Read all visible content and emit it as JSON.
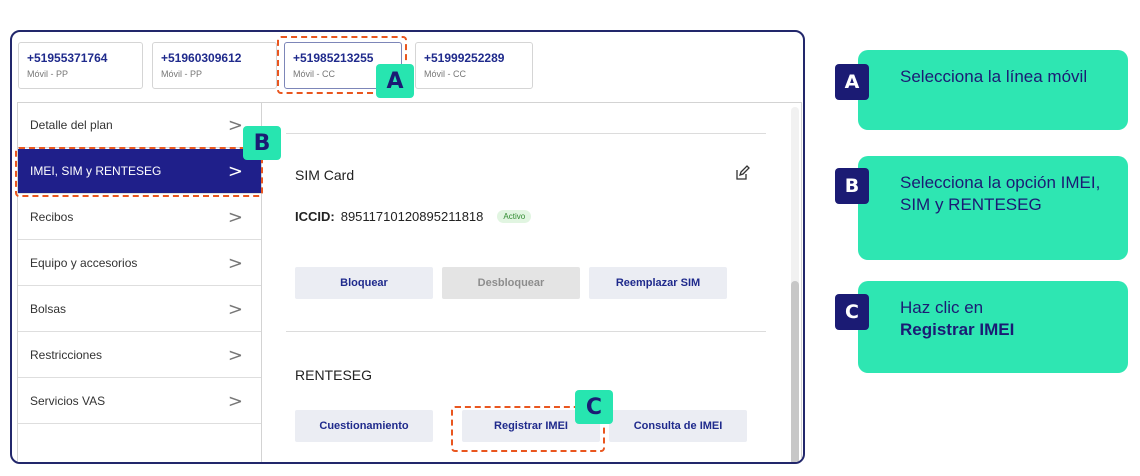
{
  "lines": [
    {
      "number": "+51955371764",
      "type": "Móvil - PP"
    },
    {
      "number": "+51960309612",
      "type": "Móvil - PP"
    },
    {
      "number": "+51985213255",
      "type": "Móvil - CC"
    },
    {
      "number": "+51999252289",
      "type": "Móvil - CC"
    }
  ],
  "sidebar": {
    "items": [
      {
        "label": "Detalle del plan"
      },
      {
        "label": "IMEI, SIM y RENTESEG"
      },
      {
        "label": "Recibos"
      },
      {
        "label": "Equipo y accesorios"
      },
      {
        "label": "Bolsas"
      },
      {
        "label": "Restricciones"
      },
      {
        "label": "Servicios VAS"
      }
    ],
    "chevron": ">"
  },
  "sim": {
    "title": "SIM Card",
    "iccid_label": "ICCID:",
    "iccid_value": "89511710120895211818",
    "status": "Activo",
    "buttons": [
      "Bloquear",
      "Desbloquear",
      "Reemplazar SIM"
    ]
  },
  "renteseg": {
    "title": "RENTESEG",
    "buttons": [
      "Cuestionamiento",
      "Registrar IMEI",
      "Consulta de IMEI"
    ]
  },
  "markers": {
    "a": "A",
    "b": "B",
    "c": "C"
  },
  "steps": [
    {
      "badge": "A",
      "text": "Selecciona la línea móvil",
      "bold": ""
    },
    {
      "badge": "B",
      "text": "Selecciona la opción IMEI, SIM y RENTESEG",
      "bold": ""
    },
    {
      "badge": "C",
      "text": "Haz clic en",
      "bold": "Registrar IMEI"
    }
  ],
  "colors": {
    "accent": "#2ee6b2",
    "navy": "#1b1b74",
    "highlight": "#e9561f",
    "active_item": "#1f1f8a"
  },
  "icons": {
    "edit": "edit-icon"
  }
}
